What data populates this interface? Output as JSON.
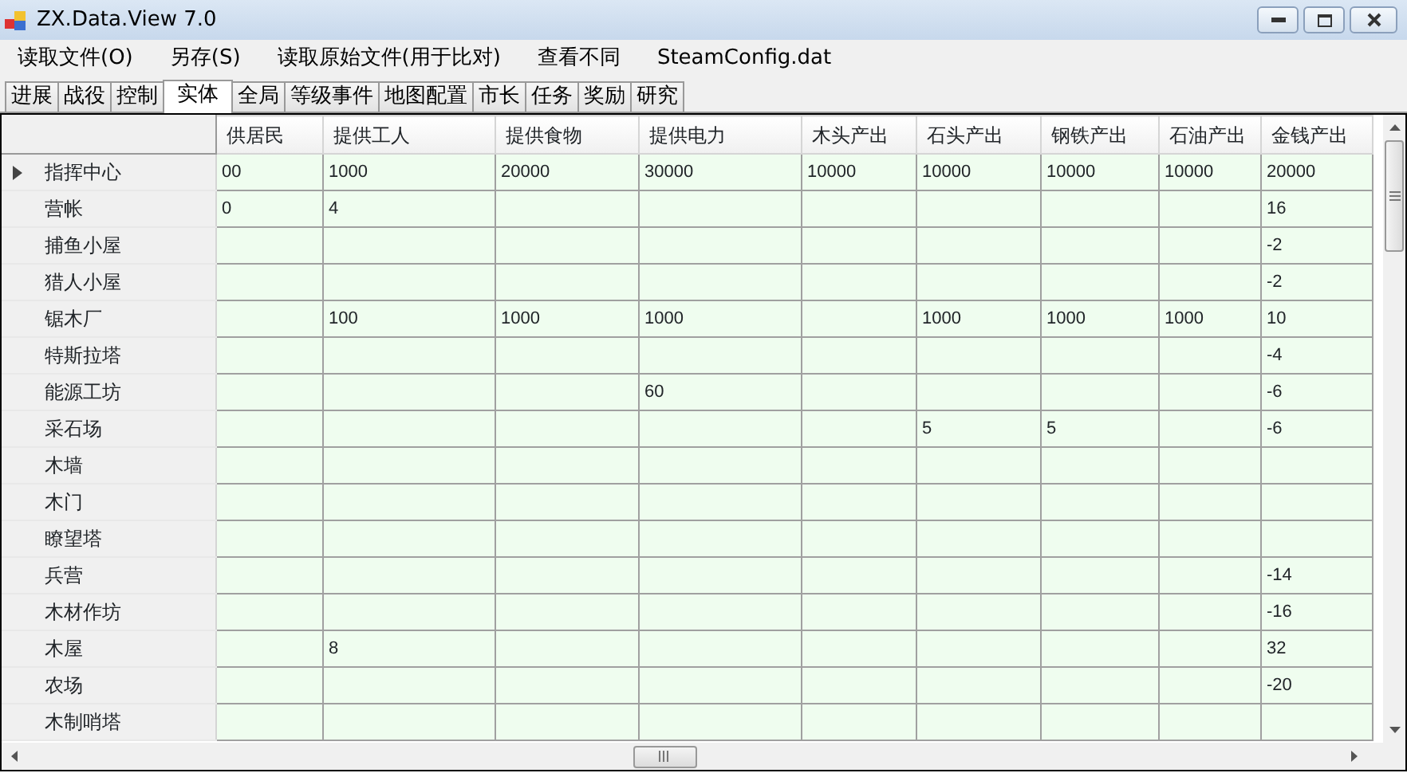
{
  "window": {
    "title": "ZX.Data.View 7.0"
  },
  "menu": [
    "读取文件(O)",
    "另存(S)",
    "读取原始文件(用于比对)",
    "查看不同",
    "SteamConfig.dat"
  ],
  "tabs": [
    {
      "label": "进展",
      "selected": false
    },
    {
      "label": "战役",
      "selected": false
    },
    {
      "label": "控制",
      "selected": false
    },
    {
      "label": "实体",
      "selected": true
    },
    {
      "label": "全局",
      "selected": false
    },
    {
      "label": "等级事件",
      "selected": false
    },
    {
      "label": "地图配置",
      "selected": false
    },
    {
      "label": "市长",
      "selected": false
    },
    {
      "label": "任务",
      "selected": false
    },
    {
      "label": "奖励",
      "selected": false
    },
    {
      "label": "研究",
      "selected": false
    }
  ],
  "table": {
    "columns": [
      "供居民",
      "提供工人",
      "提供食物",
      "提供电力",
      "木头产出",
      "石头产出",
      "钢铁产出",
      "石油产出",
      "金钱产出"
    ],
    "rows": [
      {
        "name": "指挥中心",
        "selected": true,
        "cells": [
          "00",
          "1000",
          "20000",
          "30000",
          "10000",
          "10000",
          "10000",
          "10000",
          "20000"
        ]
      },
      {
        "name": "营帐",
        "selected": false,
        "cells": [
          "0",
          "4",
          null,
          null,
          null,
          null,
          null,
          null,
          "16"
        ]
      },
      {
        "name": "捕鱼小屋",
        "selected": false,
        "cells": [
          null,
          null,
          null,
          null,
          null,
          null,
          null,
          null,
          "-2"
        ]
      },
      {
        "name": "猎人小屋",
        "selected": false,
        "cells": [
          null,
          null,
          null,
          null,
          null,
          null,
          null,
          null,
          "-2"
        ]
      },
      {
        "name": "锯木厂",
        "selected": false,
        "cells": [
          null,
          "100",
          "1000",
          "1000",
          null,
          "1000",
          "1000",
          "1000",
          "10"
        ]
      },
      {
        "name": "特斯拉塔",
        "selected": false,
        "cells": [
          null,
          null,
          null,
          null,
          null,
          null,
          null,
          null,
          "-4"
        ]
      },
      {
        "name": "能源工坊",
        "selected": false,
        "cells": [
          null,
          null,
          null,
          "60",
          null,
          null,
          null,
          null,
          "-6"
        ]
      },
      {
        "name": "采石场",
        "selected": false,
        "cells": [
          null,
          null,
          null,
          null,
          null,
          "5",
          "5",
          null,
          "-6"
        ]
      },
      {
        "name": "木墙",
        "selected": false,
        "cells": [
          null,
          null,
          null,
          null,
          null,
          null,
          null,
          null,
          null
        ]
      },
      {
        "name": "木门",
        "selected": false,
        "cells": [
          null,
          null,
          null,
          null,
          null,
          null,
          null,
          null,
          null
        ]
      },
      {
        "name": "瞭望塔",
        "selected": false,
        "cells": [
          null,
          null,
          null,
          null,
          null,
          null,
          null,
          null,
          null
        ]
      },
      {
        "name": "兵营",
        "selected": false,
        "cells": [
          null,
          null,
          null,
          null,
          null,
          null,
          null,
          null,
          "-14"
        ]
      },
      {
        "name": "木材作坊",
        "selected": false,
        "cells": [
          null,
          null,
          null,
          null,
          null,
          null,
          null,
          null,
          "-16"
        ]
      },
      {
        "name": "木屋",
        "selected": false,
        "cells": [
          null,
          "8",
          null,
          null,
          null,
          null,
          null,
          null,
          "32"
        ]
      },
      {
        "name": "农场",
        "selected": false,
        "cells": [
          null,
          null,
          null,
          null,
          null,
          null,
          null,
          null,
          "-20"
        ]
      },
      {
        "name": "木制哨塔",
        "selected": false,
        "cells": [
          null,
          null,
          null,
          null,
          null,
          null,
          null,
          null,
          null
        ]
      }
    ]
  }
}
